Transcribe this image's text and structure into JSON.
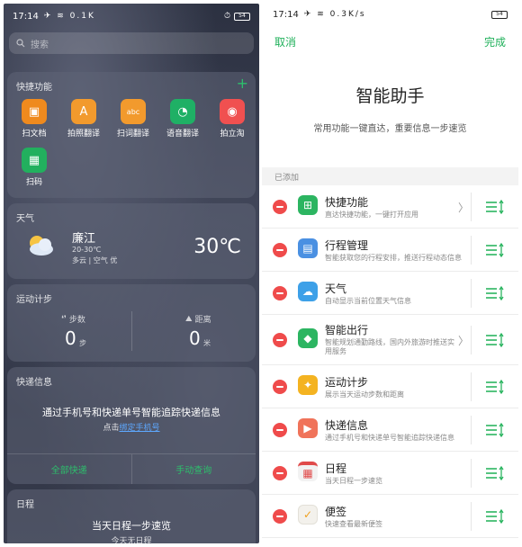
{
  "left": {
    "status": {
      "time": "17:14",
      "icons": "✈ ≋ 0.1K",
      "battery": "54"
    },
    "search": {
      "placeholder": "搜索"
    },
    "shortcuts": {
      "title": "快捷功能",
      "add_icon": "+",
      "items": [
        {
          "label": "扫文档",
          "icon": "doc-scan-icon",
          "glyph": "▣",
          "color": "#ef8a1e"
        },
        {
          "label": "拍照翻译",
          "icon": "photo-translate-icon",
          "glyph": "A",
          "color": "#f29a2d"
        },
        {
          "label": "扫词翻译",
          "icon": "word-scan-icon",
          "glyph": "abc",
          "color": "#f29a2d"
        },
        {
          "label": "语音翻译",
          "icon": "voice-translate-icon",
          "glyph": "◔",
          "color": "#1fb065"
        },
        {
          "label": "拍立淘",
          "icon": "camera-icon",
          "glyph": "◉",
          "color": "#f05050"
        },
        {
          "label": "扫码",
          "icon": "qr-scan-icon",
          "glyph": "▦",
          "color": "#22b05e"
        }
      ]
    },
    "weather": {
      "title": "天气",
      "city": "廉江",
      "range": "20-30℃",
      "desc": "多云 | 空气 优",
      "temp": "30℃"
    },
    "steps": {
      "title": "运动计步",
      "steps_label": "步数",
      "steps_value": "0",
      "steps_unit": "步",
      "distance_label": "距离",
      "distance_value": "0",
      "distance_unit": "米"
    },
    "express": {
      "title": "快递信息",
      "main": "通过手机号和快递单号智能追踪快递信息",
      "sub_prefix": "点击",
      "sub_link": "绑定手机号",
      "btn_all": "全部快递",
      "btn_manual": "手动查询"
    },
    "schedule": {
      "title": "日程",
      "main": "当天日程一步速览",
      "sub": "今天无日程"
    }
  },
  "right": {
    "status": {
      "time": "17:14",
      "icons": "✈ ≋ 0.3K/s",
      "battery": "54"
    },
    "nav": {
      "cancel": "取消",
      "done": "完成"
    },
    "title": "智能助手",
    "subtitle": "常用功能一键直达，重要信息一步速览",
    "section": "已添加",
    "items": [
      {
        "name": "快捷功能",
        "desc": "直达快捷功能，一键打开应用",
        "icon": "shortcuts-icon",
        "glyph": "⊞",
        "color": "#2cb561",
        "chevron": "〉"
      },
      {
        "name": "行程管理",
        "desc": "智能获取您的行程安排，推送行程动态信息",
        "icon": "itinerary-icon",
        "glyph": "▤",
        "color": "#4a90e2",
        "chevron": ""
      },
      {
        "name": "天气",
        "desc": "自动显示当前位置天气信息",
        "icon": "weather-icon",
        "glyph": "☁",
        "color": "#3da0e8",
        "chevron": ""
      },
      {
        "name": "智能出行",
        "desc": "智能规划通勤路线，国内外旅游时推送实用服务",
        "icon": "travel-icon",
        "glyph": "◆",
        "color": "#2cb561",
        "chevron": "〉"
      },
      {
        "name": "运动计步",
        "desc": "展示当天运动步数和距离",
        "icon": "run-icon",
        "glyph": "✦",
        "color": "#f4b321",
        "chevron": ""
      },
      {
        "name": "快递信息",
        "desc": "通过手机号和快递单号智能追踪快递信息",
        "icon": "delivery-icon",
        "glyph": "▶",
        "color": "#f0735a",
        "chevron": ""
      },
      {
        "name": "日程",
        "desc": "当天日程一步速览",
        "icon": "calendar-icon",
        "glyph": "▦",
        "color": "#f2f2f2",
        "chevron": ""
      },
      {
        "name": "便签",
        "desc": "快速查看最新便签",
        "icon": "note-icon",
        "glyph": "✓",
        "color": "#f3f1ec",
        "chevron": ""
      }
    ]
  }
}
